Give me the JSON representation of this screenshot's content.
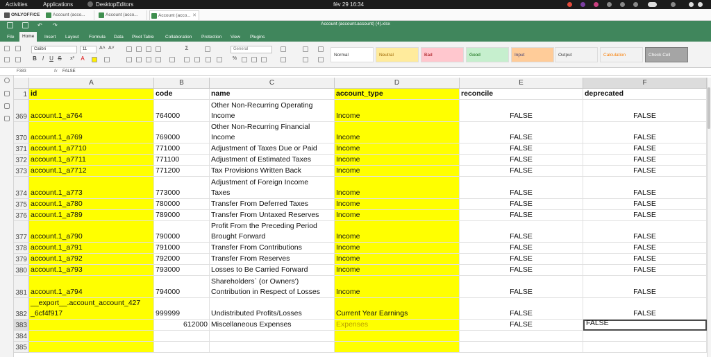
{
  "topbar": {
    "activities": "Activities",
    "applications": "Applications",
    "app_name": "DesktopEditors",
    "clock": "fév 29  16:34"
  },
  "app_tabs": [
    {
      "label": "ONLYOFFICE"
    },
    {
      "label": "Account (acco..."
    },
    {
      "label": "Account (acco..."
    },
    {
      "label": "Account (acco...",
      "close": "✕"
    }
  ],
  "window_title": "Account (account.account) (4).xlsx",
  "ribbon_tabs": [
    "File",
    "Home",
    "Insert",
    "Layout",
    "Formula",
    "Data",
    "Pivot Table",
    "Collaboration",
    "Protection",
    "View",
    "Plugins"
  ],
  "toolbar": {
    "font_name": "Calibri",
    "font_size": "11",
    "number_format": "General",
    "cell_styles": [
      {
        "label": "Normal",
        "bg": "#ffffff",
        "fg": "#333333"
      },
      {
        "label": "Neutral",
        "bg": "#ffeb9c",
        "fg": "#9c6500"
      },
      {
        "label": "Bad",
        "bg": "#ffc7ce",
        "fg": "#9c0006"
      },
      {
        "label": "Good",
        "bg": "#c6efce",
        "fg": "#006100"
      },
      {
        "label": "Input",
        "bg": "#ffcc99",
        "fg": "#3f3f76"
      },
      {
        "label": "Output",
        "bg": "#f2f2f2",
        "fg": "#3f3f3f"
      },
      {
        "label": "Calculation",
        "bg": "#f2f2f2",
        "fg": "#fa7d00"
      },
      {
        "label": "Check Cell",
        "bg": "#a5a5a5",
        "fg": "#ffffff"
      }
    ]
  },
  "formula_bar": {
    "name_box": "F383",
    "fx": "fx",
    "value": "FALSE"
  },
  "columns": [
    {
      "id": "A",
      "header": "id"
    },
    {
      "id": "B",
      "header": "code"
    },
    {
      "id": "C",
      "header": "name"
    },
    {
      "id": "D",
      "header": "account_type"
    },
    {
      "id": "E",
      "header": "reconcile"
    },
    {
      "id": "F",
      "header": "deprecated"
    }
  ],
  "header_row_number": "1",
  "rows": [
    {
      "num": "369",
      "id": [
        "account.1_a764"
      ],
      "code": "764000",
      "name": [
        "Other Non-Recurring Operating",
        "Income"
      ],
      "type": "Income",
      "reconcile": "FALSE",
      "deprecated": "FALSE"
    },
    {
      "num": "370",
      "id": [
        "account.1_a769"
      ],
      "code": "769000",
      "name": [
        "Other Non-Recurring Financial",
        "Income"
      ],
      "type": "Income",
      "reconcile": "FALSE",
      "deprecated": "FALSE"
    },
    {
      "num": "371",
      "id": [
        "account.1_a7710"
      ],
      "code": "771000",
      "name": [
        "Adjustment of Taxes Due or Paid"
      ],
      "type": "Income",
      "reconcile": "FALSE",
      "deprecated": "FALSE"
    },
    {
      "num": "372",
      "id": [
        "account.1_a7711"
      ],
      "code": "771100",
      "name": [
        "Adjustment of Estimated Taxes"
      ],
      "type": "Income",
      "reconcile": "FALSE",
      "deprecated": "FALSE"
    },
    {
      "num": "373",
      "id": [
        "account.1_a7712"
      ],
      "code": "771200",
      "name": [
        "Tax Provisions Written Back"
      ],
      "type": "Income",
      "reconcile": "FALSE",
      "deprecated": "FALSE"
    },
    {
      "num": "374",
      "id": [
        "account.1_a773"
      ],
      "code": "773000",
      "name": [
        "Adjustment of Foreign Income",
        "Taxes"
      ],
      "type": "Income",
      "reconcile": "FALSE",
      "deprecated": "FALSE"
    },
    {
      "num": "375",
      "id": [
        "account.1_a780"
      ],
      "code": "780000",
      "name": [
        "Transfer From Deferred Taxes"
      ],
      "type": "Income",
      "reconcile": "FALSE",
      "deprecated": "FALSE"
    },
    {
      "num": "376",
      "id": [
        "account.1_a789"
      ],
      "code": "789000",
      "name": [
        "Transfer From Untaxed Reserves"
      ],
      "type": "Income",
      "reconcile": "FALSE",
      "deprecated": "FALSE"
    },
    {
      "num": "377",
      "id": [
        "account.1_a790"
      ],
      "code": "790000",
      "name": [
        "Profit From the Preceding Period",
        "Brought Forward"
      ],
      "type": "Income",
      "reconcile": "FALSE",
      "deprecated": "FALSE"
    },
    {
      "num": "378",
      "id": [
        "account.1_a791"
      ],
      "code": "791000",
      "name": [
        "Transfer From Contributions"
      ],
      "type": "Income",
      "reconcile": "FALSE",
      "deprecated": "FALSE"
    },
    {
      "num": "379",
      "id": [
        "account.1_a792"
      ],
      "code": "792000",
      "name": [
        "Transfer From Reserves"
      ],
      "type": "Income",
      "reconcile": "FALSE",
      "deprecated": "FALSE"
    },
    {
      "num": "380",
      "id": [
        "account.1_a793"
      ],
      "code": "793000",
      "name": [
        "Losses to Be Carried Forward"
      ],
      "type": "Income",
      "reconcile": "FALSE",
      "deprecated": "FALSE"
    },
    {
      "num": "381",
      "id": [
        "account.1_a794"
      ],
      "code": "794000",
      "name": [
        "Shareholders` (or Owners')",
        "Contribution in Respect of Losses"
      ],
      "type": "Income",
      "reconcile": "FALSE",
      "deprecated": "FALSE"
    },
    {
      "num": "382",
      "id": [
        "__export__.account_account_427",
        "_6cf4f917"
      ],
      "code": "999999",
      "name": [
        "Undistributed Profits/Losses"
      ],
      "type": "Current Year Earnings",
      "reconcile": "FALSE",
      "deprecated": "FALSE"
    },
    {
      "num": "383",
      "id": [
        ""
      ],
      "code": "612000",
      "name": [
        "Miscellaneous Expenses"
      ],
      "type": "Expenses",
      "reconcile": "FALSE",
      "deprecated": "FALSE",
      "active": true
    },
    {
      "num": "384",
      "id": [
        ""
      ],
      "code": "",
      "name": [
        ""
      ],
      "type": "",
      "reconcile": "",
      "deprecated": ""
    },
    {
      "num": "385",
      "id": [
        ""
      ],
      "code": "",
      "name": [
        ""
      ],
      "type": "",
      "reconcile": "",
      "deprecated": ""
    }
  ]
}
